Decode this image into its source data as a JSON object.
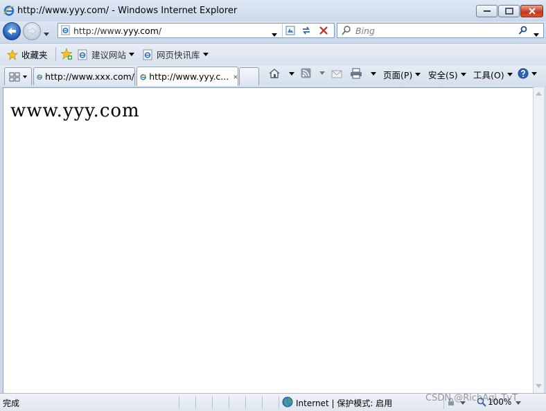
{
  "window": {
    "title": "http://www.yyy.com/ - Windows Internet Explorer"
  },
  "address": {
    "prefix": "http://www.",
    "domain": "yyy.com",
    "suffix": "/"
  },
  "search": {
    "placeholder": "Bing"
  },
  "favorites": {
    "favorites_label": "收藏夹",
    "suggested_sites": "建议网站",
    "web_slice_gallery": "网页快讯库"
  },
  "tabs": [
    {
      "title": "http://www.xxx.com/"
    },
    {
      "title": "http://www.yyy.c..."
    }
  ],
  "commands": {
    "page": "页面(P)",
    "safety": "安全(S)",
    "tools": "工具(O)"
  },
  "page": {
    "heading": "www.yyy.com"
  },
  "status": {
    "text": "完成",
    "zone": "Internet | 保护模式: 启用",
    "zoom": "100%"
  },
  "watermark": "CSDN @RichAgi_TvT"
}
